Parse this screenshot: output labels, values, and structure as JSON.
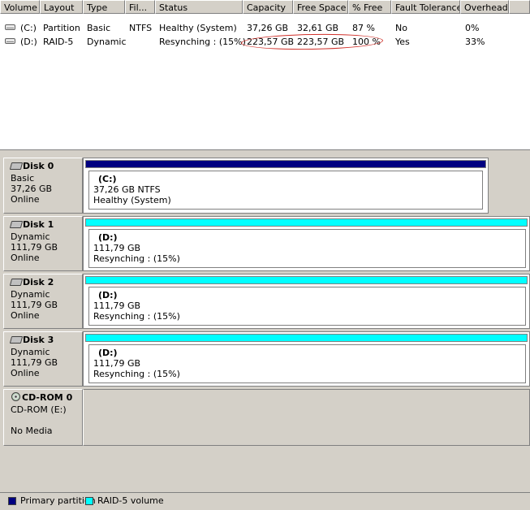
{
  "volume_list": {
    "columns": [
      "Volume",
      "Layout",
      "Type",
      "Fil...",
      "Status",
      "Capacity",
      "Free Space",
      "% Free",
      "Fault Tolerance",
      "Overhead"
    ],
    "rows": [
      {
        "volume": "(C:)",
        "layout": "Partition",
        "type": "Basic",
        "fs": "NTFS",
        "status": "Healthy (System)",
        "capacity": "37,26 GB",
        "free_space": "32,61 GB",
        "pct_free": "87 %",
        "fault_tolerance": "No",
        "overhead": "0%"
      },
      {
        "volume": "(D:)",
        "layout": "RAID-5",
        "type": "Dynamic",
        "fs": "",
        "status": "Resynching : (15%)",
        "capacity": "223,57 GB",
        "free_space": "223,57 GB",
        "pct_free": "100 %",
        "fault_tolerance": "Yes",
        "overhead": "33%"
      }
    ]
  },
  "disks": [
    {
      "name": "Disk 0",
      "type": "Basic",
      "size": "37,26 GB",
      "state": "Online",
      "volume": {
        "label": "(C:)",
        "line1": "37,26 GB NTFS",
        "line2": "Healthy (System)"
      },
      "bar_color": "#000080"
    },
    {
      "name": "Disk 1",
      "type": "Dynamic",
      "size": "111,79 GB",
      "state": "Online",
      "volume": {
        "label": "(D:)",
        "line1": "111,79 GB",
        "line2": "Resynching : (15%)"
      },
      "bar_color": "#00ffff"
    },
    {
      "name": "Disk 2",
      "type": "Dynamic",
      "size": "111,79 GB",
      "state": "Online",
      "volume": {
        "label": "(D:)",
        "line1": "111,79 GB",
        "line2": "Resynching : (15%)"
      },
      "bar_color": "#00ffff"
    },
    {
      "name": "Disk 3",
      "type": "Dynamic",
      "size": "111,79 GB",
      "state": "Online",
      "volume": {
        "label": "(D:)",
        "line1": "111,79 GB",
        "line2": "Resynching : (15%)"
      },
      "bar_color": "#00ffff"
    }
  ],
  "cdrom": {
    "name": "CD-ROM 0",
    "drive": "CD-ROM (E:)",
    "media": "No Media"
  },
  "legend": [
    {
      "label": "Primary partition",
      "color": "#000080"
    },
    {
      "label": "RAID-5 volume",
      "color": "#00ffff"
    }
  ]
}
